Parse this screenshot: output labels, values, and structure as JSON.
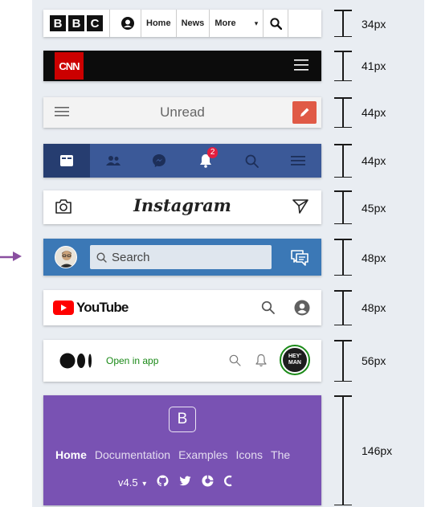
{
  "bars": {
    "bbc": {
      "logo_letters": [
        "B",
        "B",
        "C"
      ],
      "nav_items": [
        "Home",
        "News"
      ],
      "more_label": "More",
      "more_arrow": "▾",
      "height_label": "34px"
    },
    "cnn": {
      "logo_text": "CNN",
      "height_label": "41px",
      "brand_color": "#cc0000"
    },
    "unread": {
      "title": "Unread",
      "height_label": "44px",
      "accent_color": "#e05a46"
    },
    "facebook": {
      "badge_count": "2",
      "height_label": "44px",
      "brand_color": "#3b5998"
    },
    "instagram": {
      "logo_text": "Instagram",
      "height_label": "45px"
    },
    "twitter": {
      "search_placeholder": "Search",
      "height_label": "48px",
      "brand_color": "#3b78b6"
    },
    "youtube": {
      "logo_text": "YouTube",
      "height_label": "48px",
      "brand_color": "#ff0000"
    },
    "medium": {
      "open_in_app": "Open in app",
      "avatar_text": "HEY' MAN",
      "height_label": "56px",
      "accent_color": "#1a8917"
    },
    "bootstrap": {
      "brand_letter": "B",
      "links": [
        "Home",
        "Documentation",
        "Examples",
        "Icons",
        "The"
      ],
      "version": "v4.5",
      "version_arrow": "▾",
      "height_label": "146px",
      "brand_color": "#7952b3"
    }
  },
  "icons": {
    "bbc": [
      "account-icon",
      "search-icon"
    ],
    "cnn": [
      "hamburger-menu-icon"
    ],
    "unread": [
      "hamburger-menu-icon",
      "pencil-icon"
    ],
    "facebook": [
      "news-feed-icon",
      "friends-icon",
      "messenger-icon",
      "bell-icon",
      "search-icon",
      "menu-icon"
    ],
    "instagram": [
      "camera-icon",
      "send-icon"
    ],
    "twitter": [
      "avatar",
      "search-icon",
      "compose-message-icon"
    ],
    "youtube": [
      "youtube-play-icon",
      "search-icon",
      "account-icon"
    ],
    "medium": [
      "medium-logo",
      "search-icon",
      "bell-icon"
    ],
    "bootstrap": [
      "github-icon",
      "twitter-icon",
      "opencollective-icon",
      "slack-icon"
    ]
  }
}
